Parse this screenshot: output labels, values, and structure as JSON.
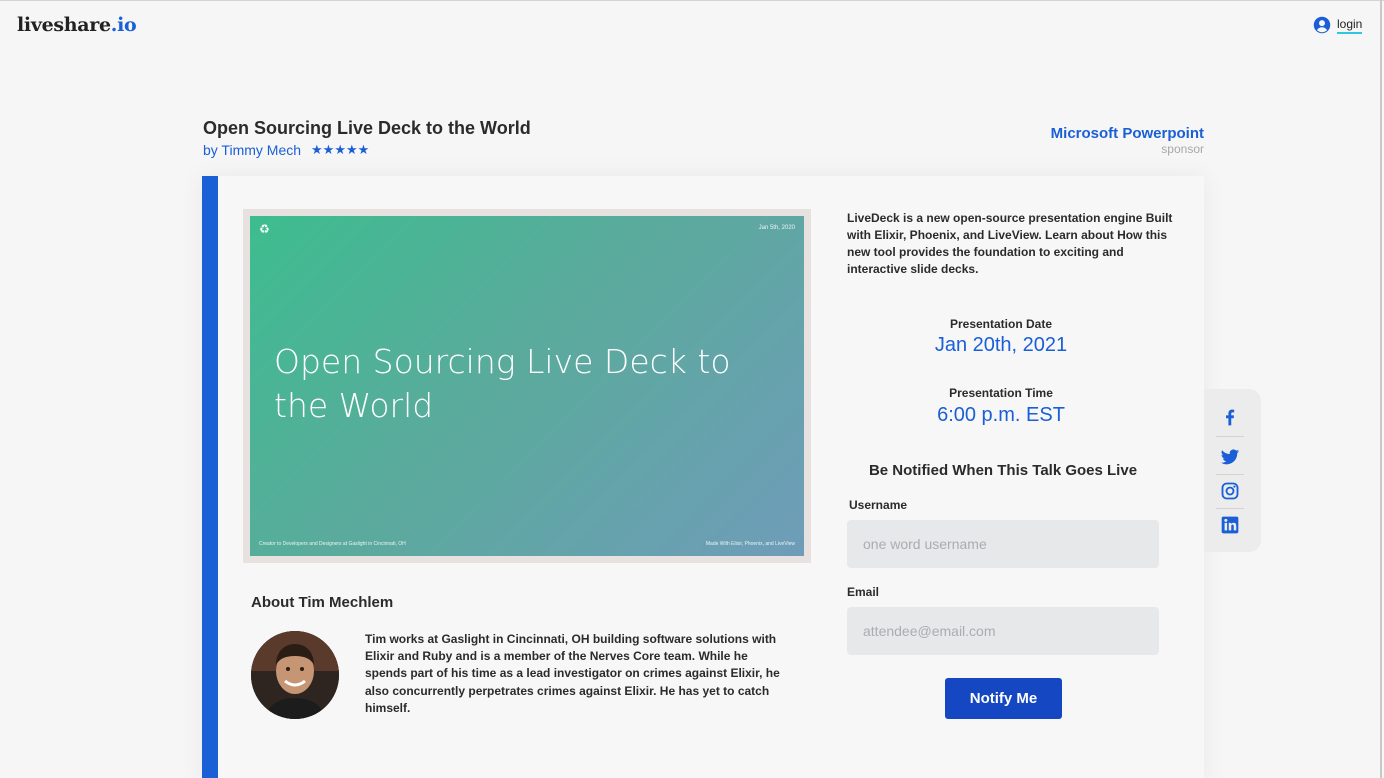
{
  "brand": {
    "name": "liveshare",
    "tld": ".io"
  },
  "header": {
    "login_label": "login",
    "login_icon": "user-circle-icon"
  },
  "talk": {
    "title": "Open Sourcing Live Deck to the World",
    "author": "by Timmy Mech",
    "rating_stars": "★★★★★",
    "rating": 5
  },
  "sponsor": {
    "name": "Microsoft Powerpoint",
    "label": "sponsor"
  },
  "slide": {
    "logo_glyph": "♻",
    "date": "Jan 5th, 2020",
    "title": "Open Sourcing Live Deck to the World",
    "footer_left": "Creator to Developers and Designers at Gaslight in Cincinnati, OH",
    "footer_right": "Made With Elixir, Phoenix, and LiveView"
  },
  "about": {
    "title": "About Tim Mechlem",
    "bio": "Tim works at Gaslight in Cincinnati, OH building software solutions with Elixir and Ruby and is a member of the Nerves Core team. While he spends part of his time as a lead investigator on crimes against Elixir, he also concurrently perpetrates crimes against Elixir. He has yet to catch himself."
  },
  "details": {
    "description": "LiveDeck is a new open-source  presentation engine Built with Elixir, Phoenix, and LiveView. Learn about How this new tool provides the foundation to exciting and interactive slide decks.",
    "date_label": "Presentation Date",
    "date_value": "Jan 20th, 2021",
    "time_label": "Presentation Time",
    "time_value": "6:00 p.m. EST"
  },
  "notify": {
    "heading": "Be Notified When This Talk Goes Live",
    "username_label": "Username",
    "username_placeholder": "one word username",
    "email_label": "Email",
    "email_placeholder": "attendee@email.com",
    "button_label": "Notify Me"
  },
  "social": {
    "icons": [
      "facebook-icon",
      "twitter-icon",
      "instagram-icon",
      "linkedin-icon"
    ],
    "color": "#1a5fd6"
  },
  "colors": {
    "accent": "#1a5fd6",
    "button": "#1447c1",
    "underline": "#2ec7e0"
  }
}
